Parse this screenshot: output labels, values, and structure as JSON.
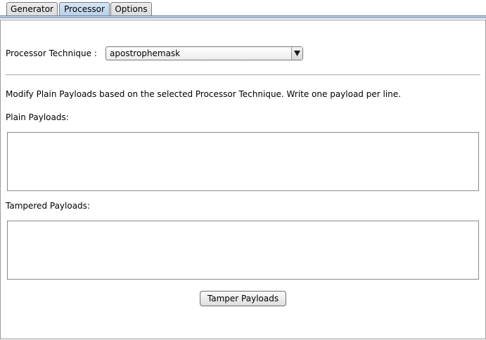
{
  "tabs": [
    {
      "label": "Generator",
      "selected": false
    },
    {
      "label": "Processor",
      "selected": true
    },
    {
      "label": "Options",
      "selected": false
    }
  ],
  "processor": {
    "technique_label": "Processor Technique :",
    "technique_value": "apostrophemask",
    "description": "Modify Plain Payloads based on the selected Processor Technique. Write one payload per line.",
    "plain_payloads_label": "Plain Payloads:",
    "plain_payloads_value": "",
    "tampered_payloads_label": "Tampered Payloads:",
    "tampered_payloads_value": "",
    "tamper_button_label": "Tamper Payloads"
  },
  "colors": {
    "selected_tab": "#b8d0ea",
    "border": "#9a9a9a"
  },
  "icons": {
    "dropdown": "triangle-down-icon"
  }
}
